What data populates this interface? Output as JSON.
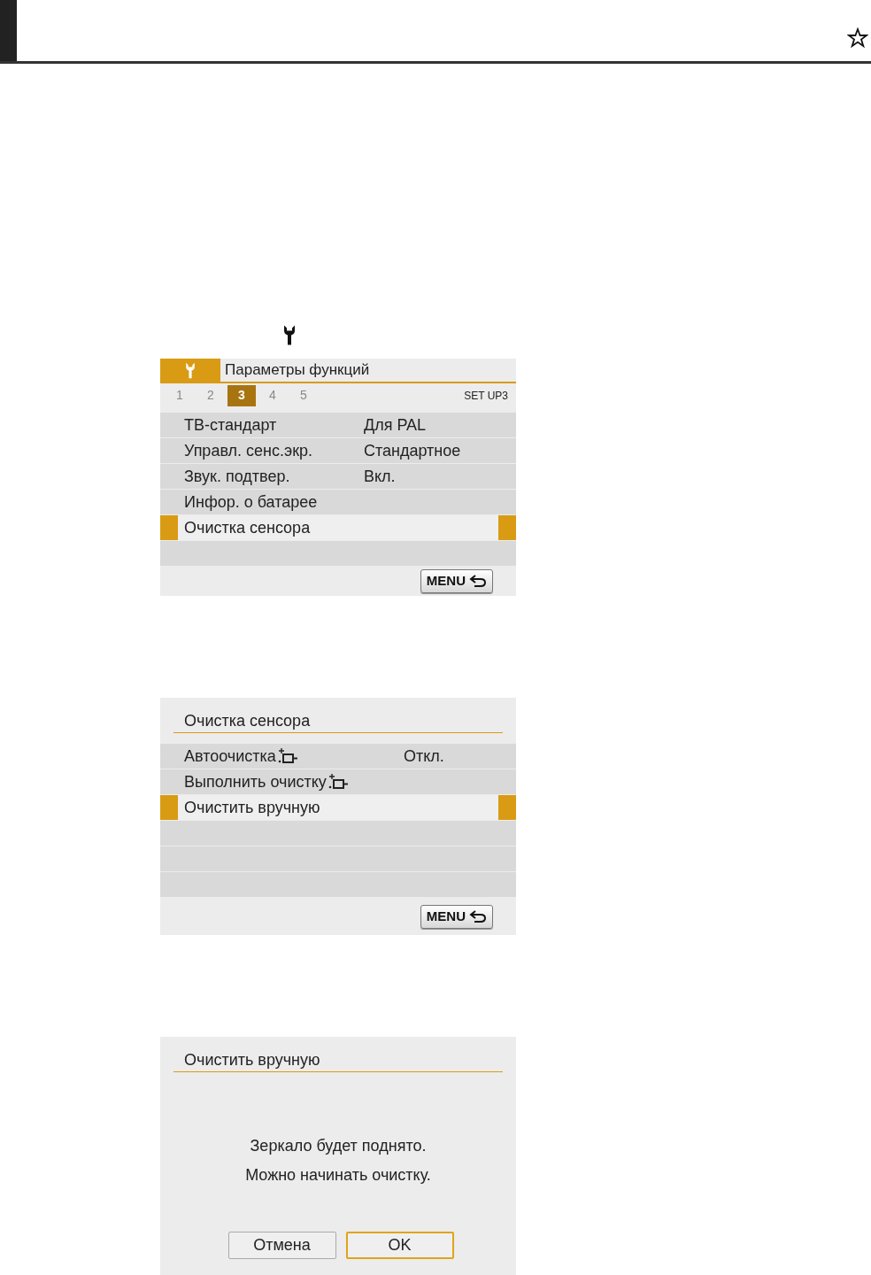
{
  "screens": [
    {
      "kind": "menu",
      "title": "Параметры функций",
      "tab_caption": "SET UP3",
      "tabs": [
        {
          "label": "1",
          "selected": false
        },
        {
          "label": "2",
          "selected": false
        },
        {
          "label": "3",
          "selected": true
        },
        {
          "label": "4",
          "selected": false
        },
        {
          "label": "5",
          "selected": false
        }
      ],
      "items": [
        {
          "label": "ТВ-стандарт",
          "value": "Для PAL",
          "selected": false
        },
        {
          "label": "Управл. сенс.экр.",
          "value": "Стандартное",
          "selected": false
        },
        {
          "label": "Звук. подтвер.",
          "value": "Вкл.",
          "selected": false
        },
        {
          "label": "Инфор. о батарее",
          "selected": false
        },
        {
          "label": "Очистка сенсора",
          "selected": true
        }
      ],
      "back_button": "MENU"
    },
    {
      "kind": "submenu",
      "title": "Очистка сенсора",
      "items": [
        {
          "label": "Автоочистка",
          "clean_icon": true,
          "value": "Откл.",
          "selected": false
        },
        {
          "label": "Выполнить очистку",
          "clean_icon": true,
          "selected": false
        },
        {
          "label": "Очистить вручную",
          "clean_icon": false,
          "selected": true
        }
      ],
      "back_button": "MENU"
    },
    {
      "kind": "dialog",
      "title": "Очистить вручную",
      "message": [
        "Зеркало будет поднято.",
        "Можно начинать очистку."
      ],
      "buttons": [
        {
          "label": "Отмена",
          "selected": false
        },
        {
          "label": "OK",
          "selected": true
        }
      ]
    }
  ]
}
